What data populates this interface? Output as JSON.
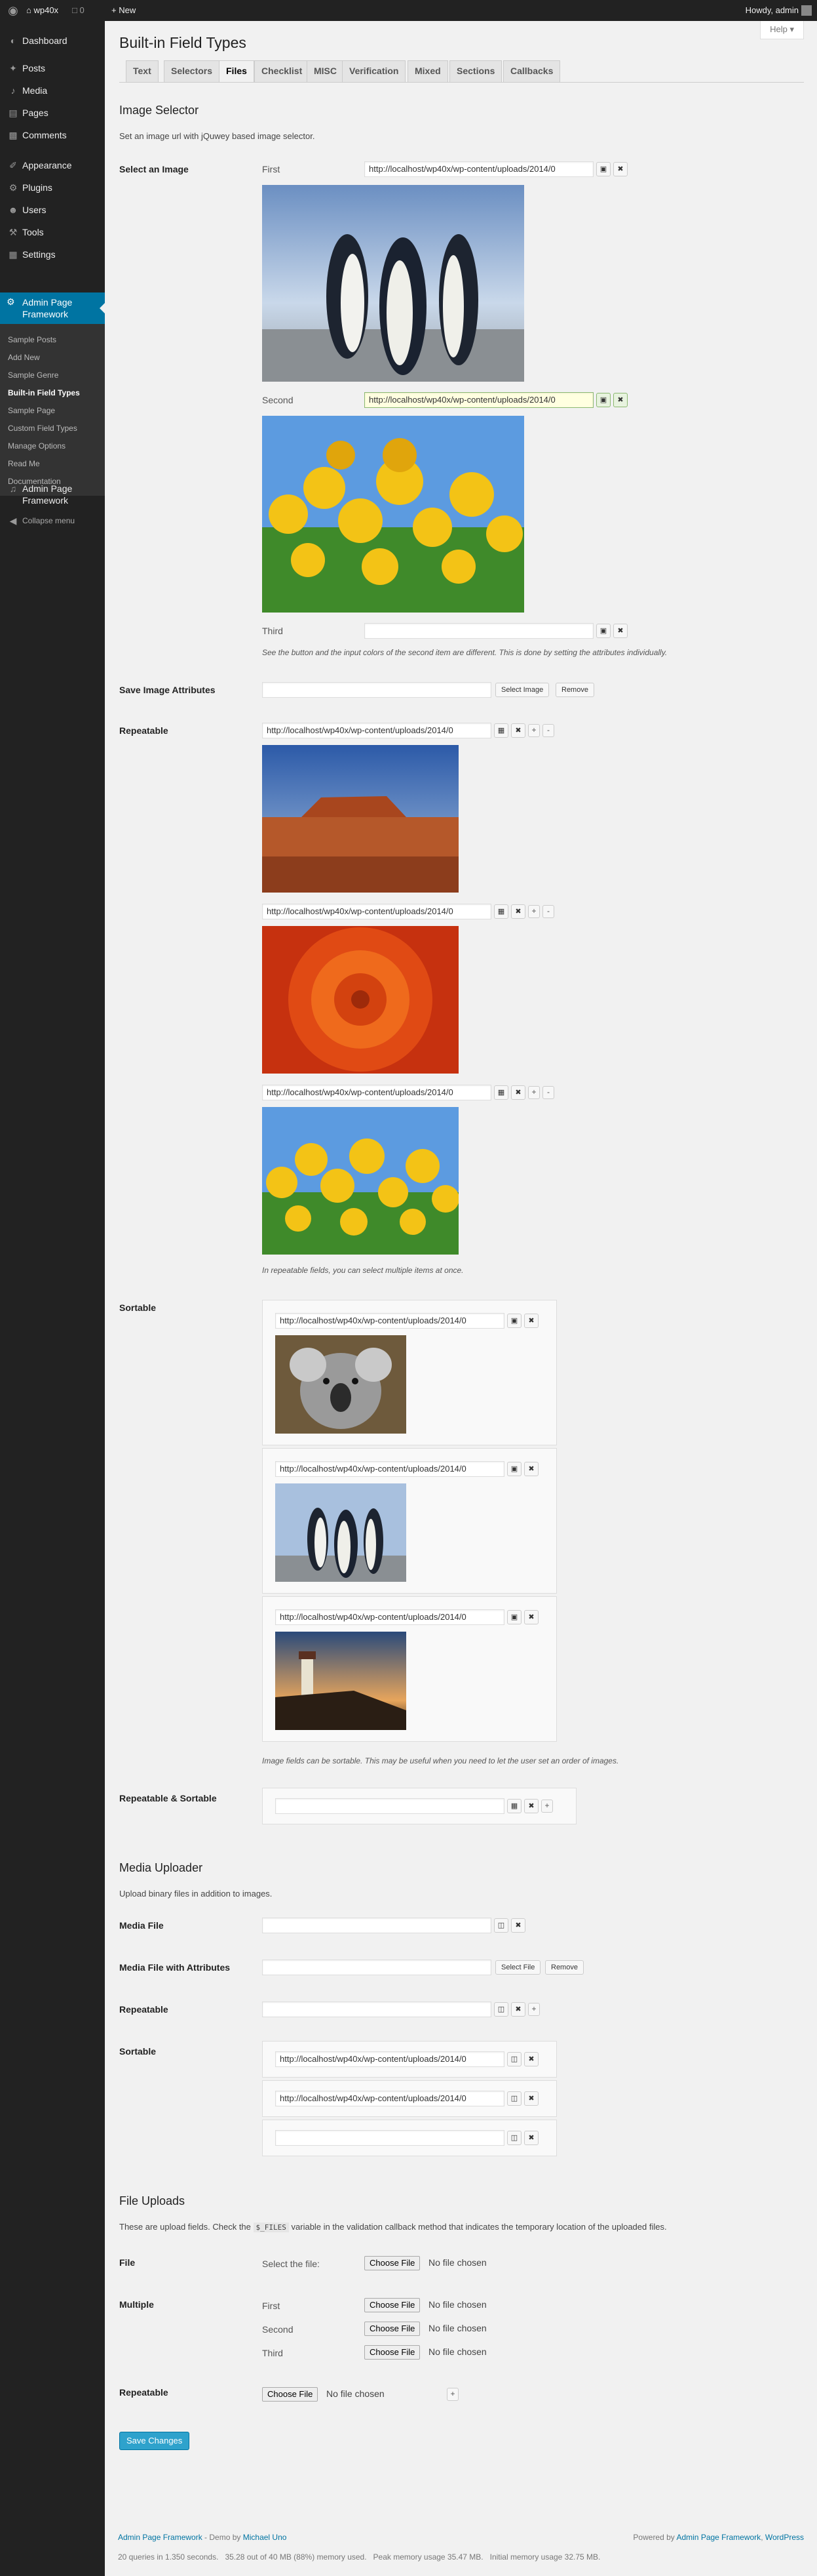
{
  "adminbar": {
    "site_name": "wp40x",
    "comments_count": "0",
    "new_label": "New",
    "howdy": "Howdy, admin"
  },
  "sidebar": {
    "items": [
      {
        "label": "Dashboard",
        "icon": "dashboard-icon"
      },
      {
        "label": "Posts",
        "icon": "pin-icon"
      },
      {
        "label": "Media",
        "icon": "media-icon"
      },
      {
        "label": "Pages",
        "icon": "pages-icon"
      },
      {
        "label": "Comments",
        "icon": "comments-icon"
      },
      {
        "label": "Appearance",
        "icon": "brush-icon"
      },
      {
        "label": "Plugins",
        "icon": "plugin-icon"
      },
      {
        "label": "Users",
        "icon": "users-icon"
      },
      {
        "label": "Tools",
        "icon": "wrench-icon"
      },
      {
        "label": "Settings",
        "icon": "settings-icon"
      }
    ],
    "current": {
      "label_line1": "Admin Page",
      "label_line2": "Framework"
    },
    "submenu": [
      "Sample Posts",
      "Add New",
      "Sample Genre",
      "Built-in Field Types",
      "Sample Page",
      "Custom Field Types",
      "Manage Options",
      "Read Me",
      "Documentation"
    ],
    "extra": {
      "label_line1": "Admin Page",
      "label_line2": "Framework"
    },
    "collapse": "Collapse menu"
  },
  "help_label": "Help",
  "page_title": "Built-in Field Types",
  "tabs": [
    "Text",
    "Selectors",
    "Files",
    "Checklist",
    "MISC",
    "Verification",
    "Mixed",
    "Sections",
    "Callbacks"
  ],
  "image_selector": {
    "heading": "Image Selector",
    "description": "Set an image url with jQuwey based image selector.",
    "select_image": {
      "label": "Select an Image",
      "first_label": "First",
      "second_label": "Second",
      "third_label": "Third",
      "url": "http://localhost/wp40x/wp-content/uploads/2014/0",
      "desc": "See the button and the input colors of the second item are different. This is done by setting the attributes individually."
    },
    "save_attrs": {
      "label": "Save Image Attributes",
      "select_btn": "Select Image",
      "remove_btn": "Remove"
    },
    "repeatable": {
      "label": "Repeatable",
      "url": "http://localhost/wp40x/wp-content/uploads/2014/0",
      "desc": "In repeatable fields, you can select multiple items at once."
    },
    "sortable": {
      "label": "Sortable",
      "url": "http://localhost/wp40x/wp-content/uploads/2014/0",
      "desc": "Image fields can be sortable. This may be useful when you need to let the user set an order of images."
    },
    "rep_sort": {
      "label": "Repeatable & Sortable"
    }
  },
  "media_uploader": {
    "heading": "Media Uploader",
    "description": "Upload binary files in addition to images.",
    "media_file": "Media File",
    "media_attrs": "Media File with Attributes",
    "select_file": "Select File",
    "remove": "Remove",
    "repeatable": "Repeatable",
    "sortable": "Sortable",
    "url": "http://localhost/wp40x/wp-content/uploads/2014/0"
  },
  "file_uploads": {
    "heading": "File Uploads",
    "desc_before": "These are upload fields. Check the",
    "desc_code": "$_FILES",
    "desc_after": "variable in the validation callback method that indicates the temporary location of the uploaded files.",
    "file_label": "File",
    "select_label": "Select the file:",
    "multiple_label": "Multiple",
    "first": "First",
    "second": "Second",
    "third": "Third",
    "repeatable_label": "Repeatable",
    "choose": "Choose File",
    "no_file": "No file chosen"
  },
  "save_button": "Save Changes",
  "footer": {
    "left_link": "Admin Page Framework",
    "left_mid": " - Demo by ",
    "left_author": "Michael Uno",
    "right_text": "Powered by ",
    "right_link1": "Admin Page Framework",
    "right_sep": ", ",
    "right_link2": "WordPress",
    "stats": "20 queries in 1.350 seconds.   35.28 out of 40 MB (88%) memory used.   Peak memory usage 35.47 MB.   Initial memory usage 32.75 MB."
  }
}
